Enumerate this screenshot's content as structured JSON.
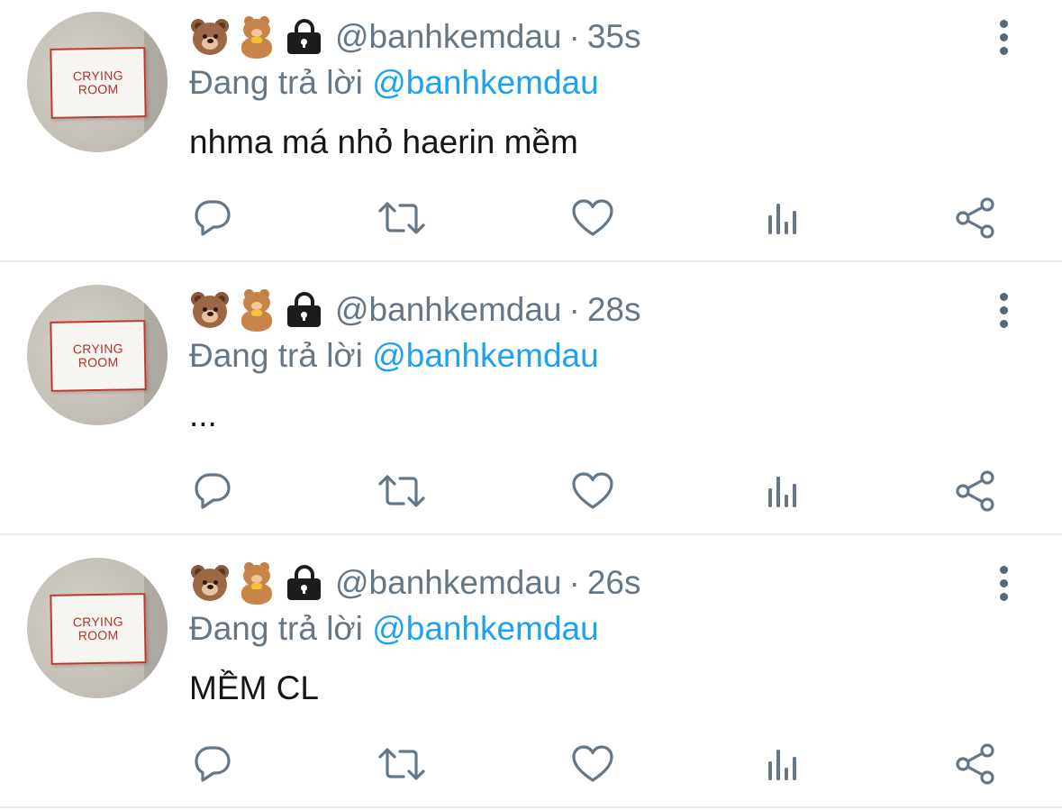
{
  "avatar": {
    "sign_text": "CRYING\nROOM"
  },
  "tweets": [
    {
      "handle": "@banhkemdau",
      "separator": "·",
      "time": "35s",
      "reply_prefix": "Đang trả lời",
      "reply_mention": "@banhkemdau",
      "text": "nhma má nhỏ haerin mềm"
    },
    {
      "handle": "@banhkemdau",
      "separator": "·",
      "time": "28s",
      "reply_prefix": "Đang trả lời",
      "reply_mention": "@banhkemdau",
      "text": "..."
    },
    {
      "handle": "@banhkemdau",
      "separator": "·",
      "time": "26s",
      "reply_prefix": "Đang trả lời",
      "reply_mention": "@banhkemdau",
      "text": "MỀM CL"
    }
  ],
  "icons": [
    "bear-face-emoji",
    "teddy-bear-emoji",
    "lock-icon",
    "more-vertical-icon",
    "reply-icon",
    "retweet-icon",
    "like-icon",
    "analytics-icon",
    "share-icon"
  ],
  "colors": {
    "secondary_text": "#657786",
    "mention": "#1da1f2",
    "primary_text": "#14171a",
    "divider": "#e6ecf0"
  }
}
